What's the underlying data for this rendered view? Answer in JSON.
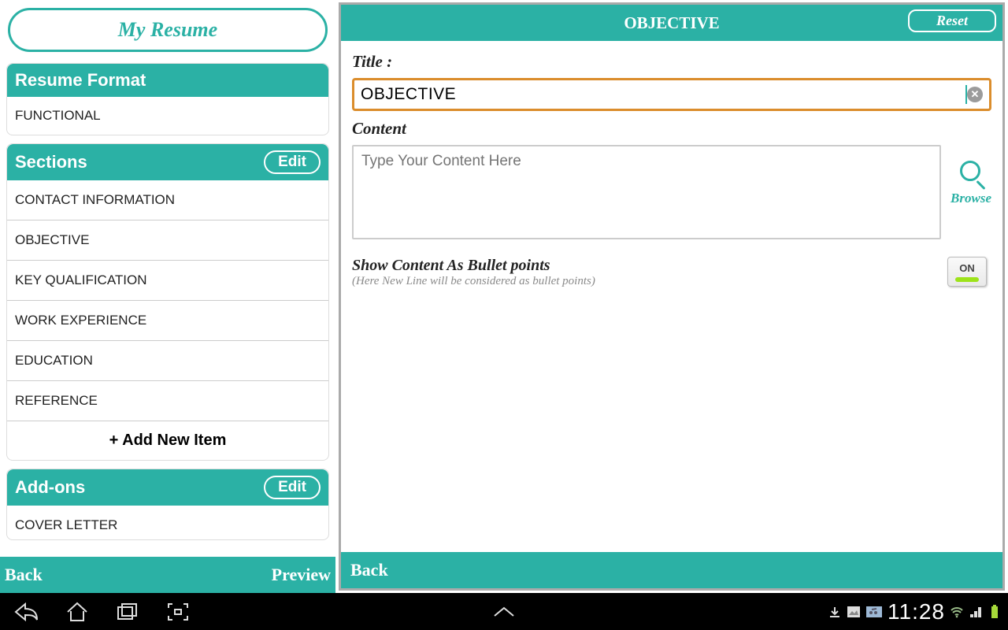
{
  "left": {
    "title": "My Resume",
    "resume_format_header": "Resume Format",
    "format_value": "FUNCTIONAL",
    "sections_header": "Sections",
    "edit_label": "Edit",
    "sections": [
      "CONTACT INFORMATION",
      "OBJECTIVE",
      "KEY QUALIFICATION",
      "WORK EXPERIENCE",
      "EDUCATION",
      "REFERENCE"
    ],
    "add_new": "+ Add New Item",
    "addons_header": "Add-ons",
    "addons": [
      "COVER LETTER"
    ],
    "back": "Back",
    "preview": "Preview"
  },
  "right": {
    "header": "OBJECTIVE",
    "reset": "Reset",
    "title_label": "Title :",
    "title_value": "OBJECTIVE",
    "content_label": "Content",
    "content_placeholder": "Type Your Content Here",
    "browse": "Browse",
    "bullet_label": "Show Content As Bullet points",
    "bullet_sub": "(Here New Line will be considered as bullet points)",
    "toggle_state": "ON",
    "back": "Back"
  },
  "statusbar": {
    "time": "11:28"
  }
}
